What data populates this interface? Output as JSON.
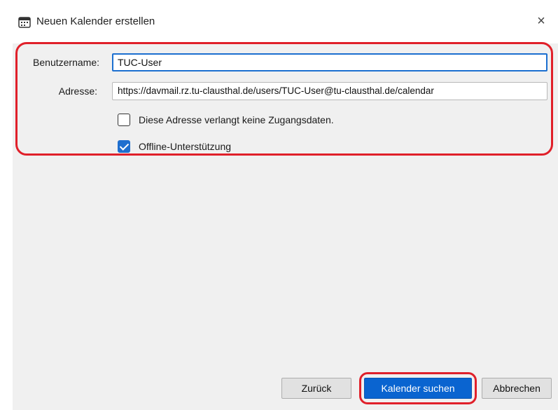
{
  "dialog": {
    "title": "Neuen Kalender erstellen",
    "close_glyph": "×"
  },
  "form": {
    "username_label": "Benutzername:",
    "username_value": "TUC-User",
    "address_label": "Adresse:",
    "address_value": "https://davmail.rz.tu-clausthal.de/users/TUC-User@tu-clausthal.de/calendar",
    "no_credentials_label": "Diese Adresse verlangt keine Zugangsdaten.",
    "no_credentials_checked": false,
    "offline_label": "Offline-Unterstützung",
    "offline_checked": true
  },
  "buttons": {
    "back_label": "Zurück",
    "find_label": "Kalender suchen",
    "cancel_label": "Abbrechen"
  },
  "colors": {
    "highlight": "#e0202a",
    "accent": "#0a64d0"
  },
  "icons": {
    "title": "calendar-icon",
    "close": "close-icon",
    "check": "checkmark-icon"
  }
}
